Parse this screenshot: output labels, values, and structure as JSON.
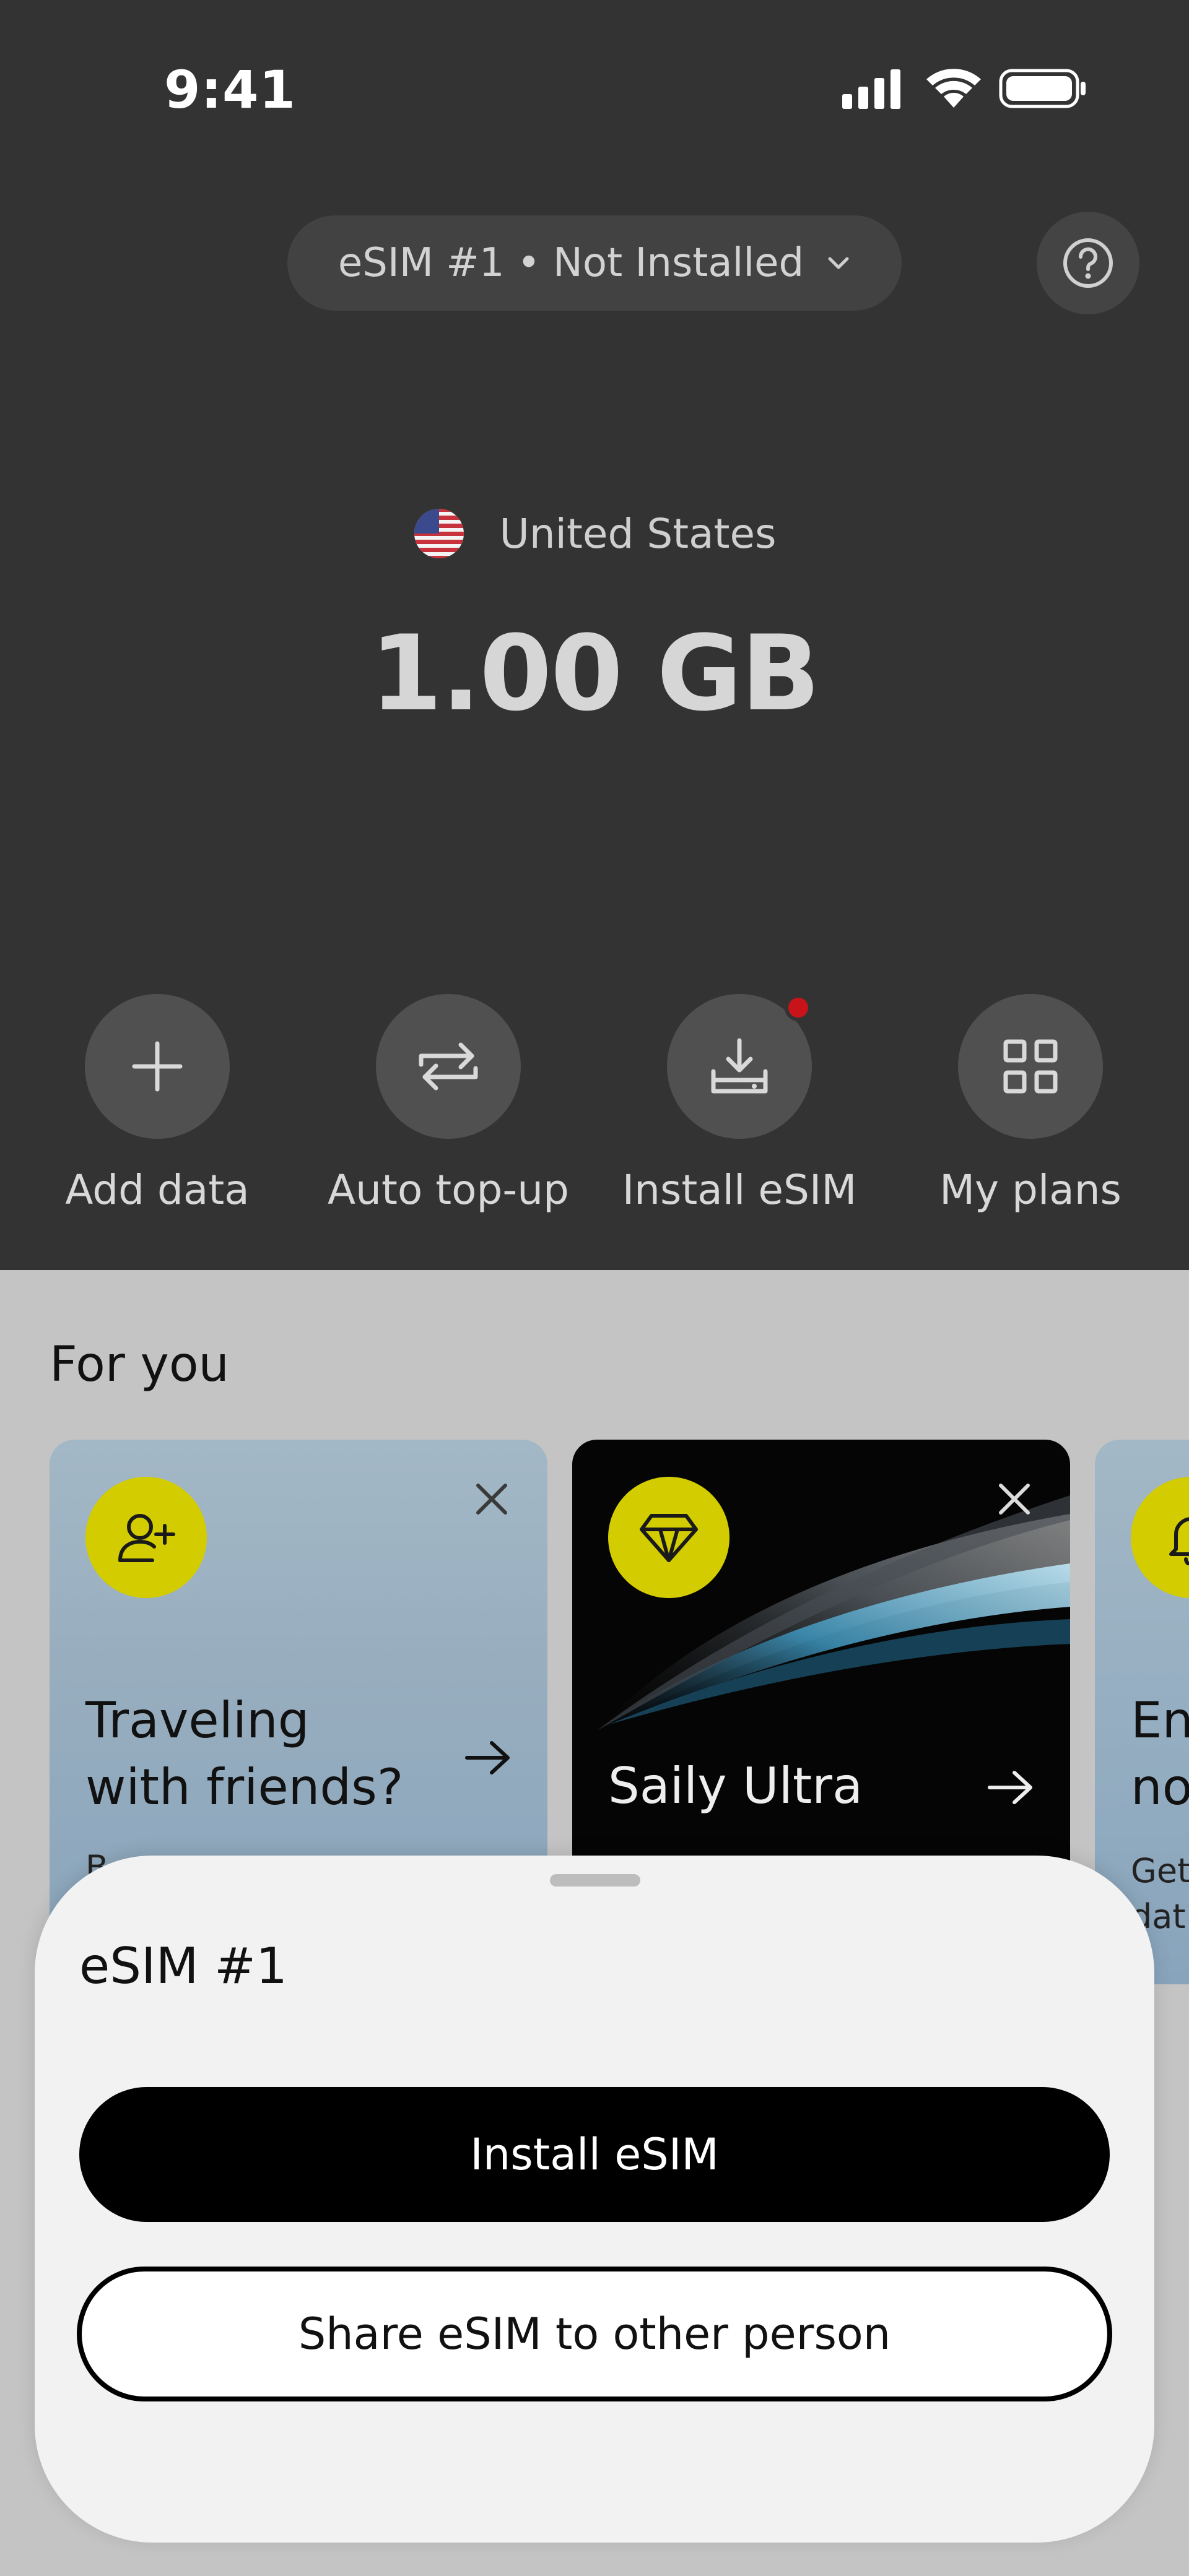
{
  "status_bar": {
    "time": "9:41",
    "icons": [
      "cellular-signal-icon",
      "wifi-icon",
      "battery-icon"
    ]
  },
  "header": {
    "esim_selector": "eSIM #1 • Not Installed",
    "help_icon": "question-circle-icon"
  },
  "plan": {
    "country": "United States",
    "flag_icon": "us-flag-icon",
    "data_amount": "1.00 GB"
  },
  "actions": [
    {
      "label": "Add data",
      "icon": "plus-icon"
    },
    {
      "label": "Auto top-up",
      "icon": "repeat-arrows-icon"
    },
    {
      "label": "Install eSIM",
      "icon": "download-tray-icon",
      "has_notification": true
    },
    {
      "label": "My plans",
      "icon": "grid-icon"
    }
  ],
  "for_you": {
    "title": "For you",
    "cards": [
      {
        "title_line1": "Traveling",
        "title_line2": "with friends?",
        "icon": "add-user-icon",
        "subtitle": "B"
      },
      {
        "title": "Saily Ultra",
        "icon": "diamond-icon"
      },
      {
        "title_line1": "En",
        "title_line2": "no",
        "icon": "bell-icon",
        "subtitle_line1": "Get",
        "subtitle_line2": "dat"
      }
    ]
  },
  "sheet": {
    "title": "eSIM #1",
    "install_label": "Install eSIM",
    "share_label": "Share eSIM to other person"
  },
  "colors": {
    "top_background": "#333333",
    "accent_yellow": "#d2cc00",
    "notification_red": "#c9131b",
    "sheet_background": "#f2f2f2"
  }
}
